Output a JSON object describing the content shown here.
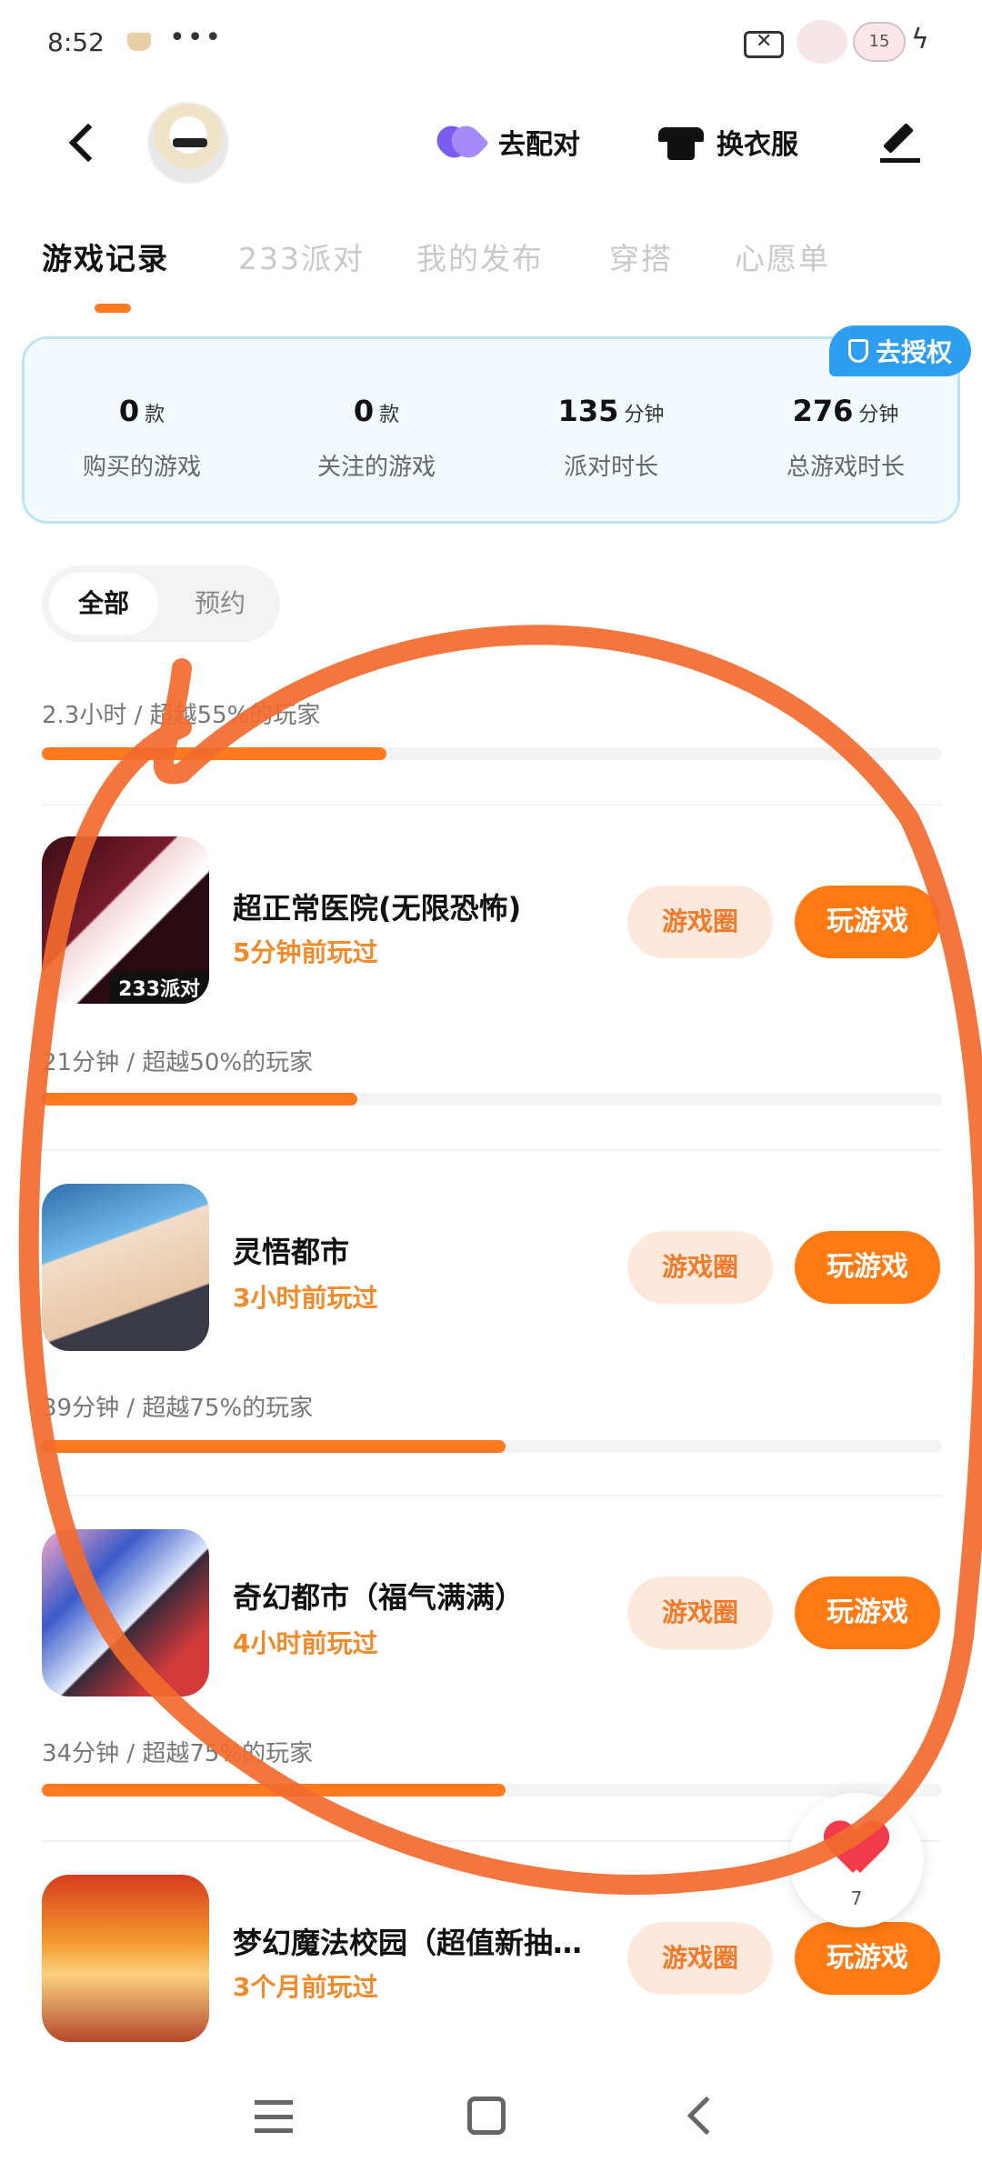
{
  "status_bar": {
    "time": "8:52",
    "dots": "•••",
    "battery": "15"
  },
  "header": {
    "pair_label": "去配对",
    "outfit_label": "换衣服"
  },
  "tabs": [
    {
      "label": "游戏记录",
      "active": true
    },
    {
      "label": "233派对"
    },
    {
      "label": "我的发布"
    },
    {
      "label": "穿搭"
    },
    {
      "label": "心愿单"
    }
  ],
  "stats": {
    "auth_label": "去授权",
    "items": [
      {
        "value": "0",
        "unit": "款",
        "label": "购买的游戏"
      },
      {
        "value": "0",
        "unit": "款",
        "label": "关注的游戏"
      },
      {
        "value": "135",
        "unit": "分钟",
        "label": "派对时长"
      },
      {
        "value": "276",
        "unit": "分钟",
        "label": "总游戏时长"
      }
    ]
  },
  "filter": {
    "all": "全部",
    "reserve": "预约"
  },
  "first_progress": {
    "text": "2.3小时 / 超越55%的玩家",
    "percent": 55
  },
  "games": [
    {
      "name": "超正常医院(无限恐怖)",
      "last_played": "5分钟前玩过",
      "tag": "233派对",
      "circle_label": "游戏圈",
      "play_label": "玩游戏",
      "progress_text": "21分钟 / 超越50%的玩家",
      "percent": 50
    },
    {
      "name": "灵悟都市",
      "last_played": "3小时前玩过",
      "circle_label": "游戏圈",
      "play_label": "玩游戏",
      "progress_text": "39分钟 / 超越75%的玩家",
      "percent": 75
    },
    {
      "name": "奇幻都市（福气满满）",
      "last_played": "4小时前玩过",
      "circle_label": "游戏圈",
      "play_label": "玩游戏",
      "progress_text": "34分钟 / 超越75%的玩家",
      "percent": 75
    },
    {
      "name": "梦幻魔法校园（超值新抽…",
      "last_played": "3个月前玩过",
      "circle_label": "游戏圈",
      "play_label": "玩游戏"
    }
  ],
  "heart_fab": {
    "count": "7"
  },
  "colors": {
    "accent": "#ff7a12",
    "auth": "#2e9ef0",
    "scribble": "#f26a2e"
  }
}
